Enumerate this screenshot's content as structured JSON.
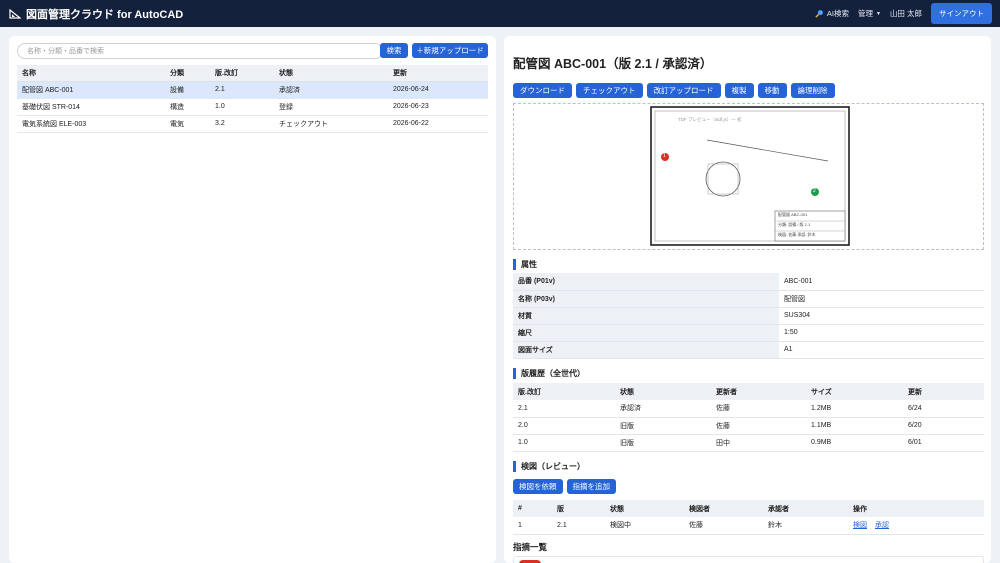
{
  "header": {
    "title": "図面管理クラウド for AutoCAD",
    "ai_search": "AI検索",
    "admin": "管理",
    "user": "山田 太郎",
    "sign_out": "サインアウト"
  },
  "list": {
    "search_placeholder": "名称・分類・品番で検索",
    "search_label": "検索",
    "upload_label": "＋新規アップロード",
    "columns": [
      "名称",
      "分類",
      "版.改訂",
      "状態",
      "更新"
    ],
    "rows": [
      {
        "name": "配管図 ABC-001",
        "category": "設備",
        "version": "2.1",
        "status": "承認済",
        "updated": "2026-06-24"
      },
      {
        "name": "基礎伏図 STR-014",
        "category": "構造",
        "version": "1.0",
        "status": "登録",
        "updated": "2026-06-23"
      },
      {
        "name": "電気系統図 ELE-003",
        "category": "電気",
        "version": "3.2",
        "status": "チェックアウト",
        "updated": "2026-06-22"
      }
    ]
  },
  "detail": {
    "title": "配管図 ABC-001（版 2.1 / 承認済）",
    "actions": [
      "ダウンロード",
      "チェックアウト",
      "改訂アップロード",
      "複製",
      "移動",
      "論理削除"
    ],
    "preview": {
      "label": "TDF プレビュー（stdf.js）― 初",
      "marker1": "1",
      "marker2": "2",
      "titleblock": [
        "配管図 ABC-001",
        "分類: 設備 / 版 2.1",
        "検図: 佐藤 承認: 鈴木"
      ]
    },
    "attributes_title": "属性",
    "attributes": [
      {
        "key": "品番 (P01v)",
        "value": "ABC-001"
      },
      {
        "key": "名称 (P03v)",
        "value": "配管図"
      },
      {
        "key": "材質",
        "value": "SUS304"
      },
      {
        "key": "縮尺",
        "value": "1:50"
      },
      {
        "key": "図面サイズ",
        "value": "A1"
      }
    ],
    "history_title": "版履歴（全世代）",
    "history_columns": [
      "版.改訂",
      "状態",
      "更新者",
      "サイズ",
      "更新"
    ],
    "history": [
      {
        "ver": "2.1",
        "status": "承認済",
        "user": "佐藤",
        "size": "1.2MB",
        "date": "6/24"
      },
      {
        "ver": "2.0",
        "status": "旧版",
        "user": "佐藤",
        "size": "1.1MB",
        "date": "6/20"
      },
      {
        "ver": "1.0",
        "status": "旧版",
        "user": "田中",
        "size": "0.9MB",
        "date": "6/01"
      }
    ],
    "review_title": "検図（レビュー）",
    "review_request": "検図を依頼",
    "review_add": "指摘を追加",
    "review_columns": [
      "#",
      "版",
      "状態",
      "検図者",
      "承認者",
      "操作"
    ],
    "reviews": [
      {
        "no": "1",
        "ver": "2.1",
        "status": "検図中",
        "reviewer": "佐藤",
        "approver": "鈴木",
        "op1": "検図",
        "op2": "承認"
      }
    ],
    "findings_title": "指摘一覧"
  },
  "colors": {
    "header_bg": "#13213d",
    "accent": "#2563d6",
    "selected_row": "#dbe7fb",
    "marker_red": "#d93025",
    "marker_green": "#1e9e4a"
  }
}
